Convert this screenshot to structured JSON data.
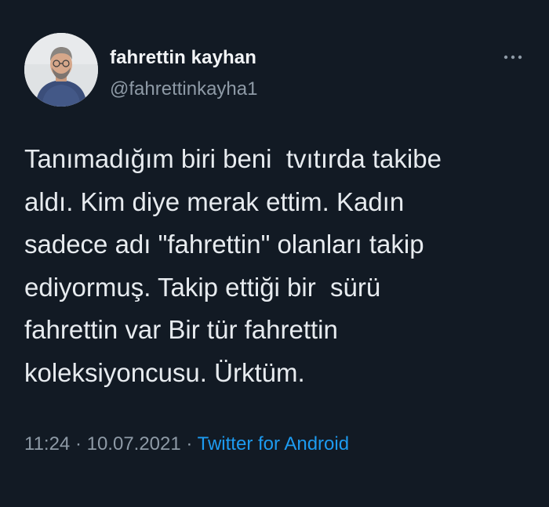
{
  "tweet": {
    "author": {
      "display_name": "fahrettin kayhan",
      "handle": "@fahrettinkayha1",
      "avatar_icon": "profile-photo"
    },
    "more_icon": "more-horizontal-icon",
    "text": "Tanımadığım biri beni  tvıtırda takibe\naldı. Kim diye merak ettim. Kadın\nsadece adı \"fahrettin\" olanları takip\nediyormuş. Takip ettiği bir  sürü\nfahrettin var Bir tür fahrettin\nkoleksiyoncusu. Ürktüm.",
    "time": "11:24",
    "separator": " · ",
    "date": "10.07.2021",
    "source": "Twitter for Android"
  },
  "colors": {
    "background": "#121a24",
    "text": "#e7ebef",
    "secondary": "#8e9aa6",
    "link": "#1d9bf0"
  }
}
